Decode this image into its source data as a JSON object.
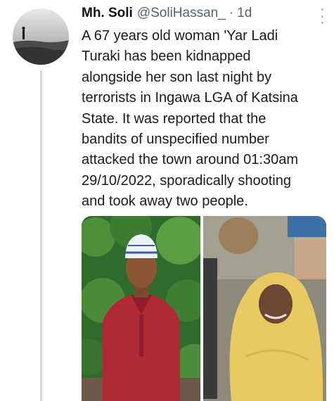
{
  "tweet": {
    "author_name": "Mh. Soli",
    "author_handle": "@SoliHassan_",
    "separator": "·",
    "timestamp": "1d",
    "text_lines": [
      "A 67 years old woman 'Yar Ladi",
      "Turaki has been kidnapped",
      "alongside her son last night by",
      "terrorists in Ingawa LGA of Katsina",
      "State. It was reported that the",
      "bandits of unspecified number",
      "attacked the town around 01:30am",
      "29/10/2022, sporadically shooting",
      "and took away two people."
    ]
  },
  "colors": {
    "name": "#0f1419",
    "secondary_text": "#536471",
    "thread_line": "#cfd9de"
  },
  "icons": {
    "more": "more-options-icon"
  }
}
